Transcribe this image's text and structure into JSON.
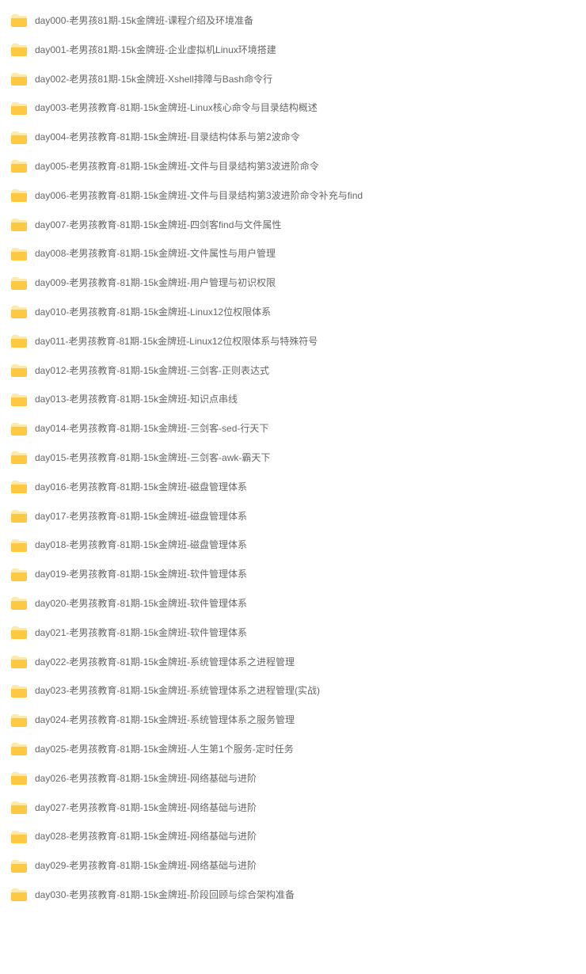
{
  "folders": [
    {
      "name": "day000-老男孩81期-15k金牌班-课程介绍及环境准备"
    },
    {
      "name": "day001-老男孩81期-15k金牌班-企业虚拟机Linux环境搭建"
    },
    {
      "name": "day002-老男孩81期-15k金牌班-Xshell排障与Bash命令行"
    },
    {
      "name": "day003-老男孩教育-81期-15k金牌班-Linux核心命令与目录结构概述"
    },
    {
      "name": "day004-老男孩教育-81期-15k金牌班-目录结构体系与第2波命令"
    },
    {
      "name": "day005-老男孩教育-81期-15k金牌班-文件与目录结构第3波进阶命令"
    },
    {
      "name": "day006-老男孩教育-81期-15k金牌班-文件与目录结构第3波进阶命令补充与find"
    },
    {
      "name": "day007-老男孩教育-81期-15k金牌班-四剑客find与文件属性"
    },
    {
      "name": "day008-老男孩教育-81期-15k金牌班-文件属性与用户管理"
    },
    {
      "name": "day009-老男孩教育-81期-15k金牌班-用户管理与初识权限"
    },
    {
      "name": "day010-老男孩教育-81期-15k金牌班-Linux12位权限体系"
    },
    {
      "name": "day011-老男孩教育-81期-15k金牌班-Linux12位权限体系与特殊符号"
    },
    {
      "name": "day012-老男孩教育-81期-15k金牌班-三剑客-正则表达式"
    },
    {
      "name": "day013-老男孩教育-81期-15k金牌班-知识点串线"
    },
    {
      "name": "day014-老男孩教育-81期-15k金牌班-三剑客-sed-行天下"
    },
    {
      "name": "day015-老男孩教育-81期-15k金牌班-三剑客-awk-霸天下"
    },
    {
      "name": "day016-老男孩教育-81期-15k金牌班-磁盘管理体系"
    },
    {
      "name": "day017-老男孩教育-81期-15k金牌班-磁盘管理体系"
    },
    {
      "name": "day018-老男孩教育-81期-15k金牌班-磁盘管理体系"
    },
    {
      "name": "day019-老男孩教育-81期-15k金牌班-软件管理体系"
    },
    {
      "name": "day020-老男孩教育-81期-15k金牌班-软件管理体系"
    },
    {
      "name": "day021-老男孩教育-81期-15k金牌班-软件管理体系"
    },
    {
      "name": "day022-老男孩教育-81期-15k金牌班-系统管理体系之进程管理"
    },
    {
      "name": "day023-老男孩教育-81期-15k金牌班-系统管理体系之进程管理(实战)"
    },
    {
      "name": "day024-老男孩教育-81期-15k金牌班-系统管理体系之服务管理"
    },
    {
      "name": "day025-老男孩教育-81期-15k金牌班-人生第1个服务-定时任务"
    },
    {
      "name": "day026-老男孩教育-81期-15k金牌班-网络基础与进阶"
    },
    {
      "name": "day027-老男孩教育-81期-15k金牌班-网络基础与进阶"
    },
    {
      "name": "day028-老男孩教育-81期-15k金牌班-网络基础与进阶"
    },
    {
      "name": "day029-老男孩教育-81期-15k金牌班-网络基础与进阶"
    },
    {
      "name": "day030-老男孩教育-81期-15k金牌班-阶段回顾与综合架构准备"
    }
  ],
  "colors": {
    "folder_light": "#ffe9a6",
    "folder_dark": "#ffc843",
    "text": "#666666"
  }
}
